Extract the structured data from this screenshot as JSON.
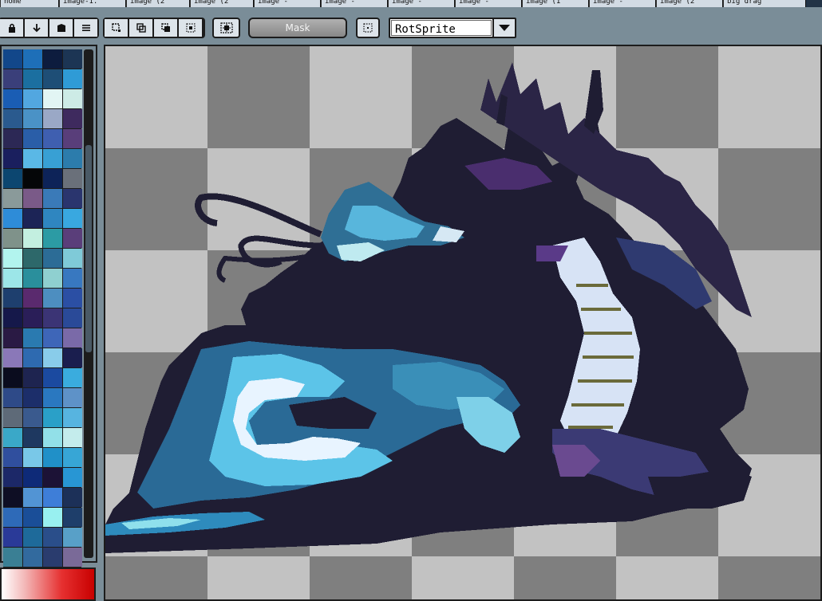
{
  "tabs": [
    {
      "label": "home"
    },
    {
      "label": "image-1."
    },
    {
      "label": "image (2"
    },
    {
      "label": "image (2"
    },
    {
      "label": "image -"
    },
    {
      "label": "image -"
    },
    {
      "label": "image -"
    },
    {
      "label": "image -"
    },
    {
      "label": "image (1"
    },
    {
      "label": "image -"
    },
    {
      "label": "image (2"
    },
    {
      "label": "big drag"
    }
  ],
  "toolbar": {
    "lock_icon": "lock-icon",
    "merge_down_icon": "arrow-down-icon",
    "layer_icon": "layer-icon",
    "menu_icon": "menu-icon",
    "mask_label": "Mask",
    "rotation_algorithm": "RotSprite"
  },
  "palette": {
    "colors": [
      "#12478a",
      "#1e6fb8",
      "#0d1c3e",
      "#1c3554",
      "#3a3f7a",
      "#1b6fa0",
      "#1e4e76",
      "#2f9bd6",
      "#1a5db4",
      "#52a7e0",
      "#e2f5f4",
      "#cdebe6",
      "#2a5a8e",
      "#4a92c6",
      "#9aa8c6",
      "#3e2a5e",
      "#2c2855",
      "#2a5ea8",
      "#3f5fb0",
      "#593e7a",
      "#1a1f5e",
      "#5ab8e6",
      "#38a0d4",
      "#2c7cac",
      "#0c4670",
      "#050608",
      "#0d2358",
      "#6a707a",
      "#8a9a9a",
      "#7a5a88",
      "#3a7ab8",
      "#2a356e",
      "#2e8cd8",
      "#1c2456",
      "#2f86c0",
      "#39a8e0",
      "#7f928a",
      "#c3efe0",
      "#2c9ba4",
      "#5a3e7a",
      "#b2f4ee",
      "#2d686a",
      "#2c6c96",
      "#7fcad8",
      "#9ce6e8",
      "#2a8f9c",
      "#8fd0d0",
      "#3878c0",
      "#1e3f6e",
      "#5a2a6e",
      "#4d8ec0",
      "#2b4fa4",
      "#15184a",
      "#2a1e58",
      "#3b3475",
      "#2a4a98",
      "#2a1a44",
      "#2a7ab0",
      "#3e66b8",
      "#7a6aa8",
      "#8a78b8",
      "#2e6ab0",
      "#89ccea",
      "#1a1e4e",
      "#0a0c1e",
      "#1e2450",
      "#1b4aa0",
      "#3aacde",
      "#2e4a88",
      "#1c2e6a",
      "#2a78c0",
      "#5e92c8",
      "#5e6a78",
      "#3a5a8e",
      "#2aa0c8",
      "#57b4e0",
      "#3aa8c8",
      "#1e3860",
      "#92e0e8",
      "#c4ecec",
      "#304f9e",
      "#79c8e8",
      "#2090c8",
      "#37a6d6",
      "#1c2868",
      "#0e2a78",
      "#1c1236",
      "#2896d4",
      "#0e0e24",
      "#5294d4",
      "#3e7ed8",
      "#1c3058",
      "#2e6ab8",
      "#1a4e98",
      "#98f0f0",
      "#1e3e6a",
      "#2a3a98",
      "#1e6a9a",
      "#2a4e8a",
      "#58a0c8",
      "#3a7f94",
      "#326a9e",
      "#2a3c6e",
      "#7a6a98",
      "#9be6f0",
      "#34a6d8",
      "#30224e",
      "#2a8ec4"
    ]
  }
}
